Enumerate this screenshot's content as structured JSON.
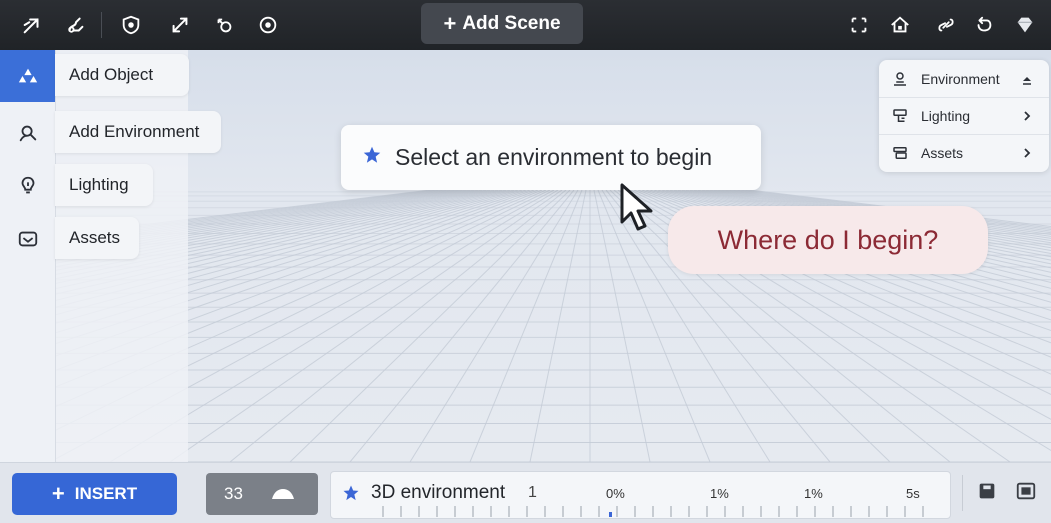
{
  "toolbar": {
    "left_icons": [
      "cursor-arrow-icon",
      "link-path-icon",
      "shield-icon",
      "scale-arrows-icon",
      "rotate-icon",
      "target-icon"
    ],
    "add_scene_label": "Add Scene",
    "right_icons": [
      "frame-icon",
      "home-icon",
      "link-icon",
      "undo-icon",
      "diamond-icon"
    ]
  },
  "sidebar": {
    "items": [
      {
        "label": "Add Object",
        "icon": "objects-icon",
        "active": true
      },
      {
        "label": "Add Environment",
        "icon": "person-search-icon",
        "active": false
      },
      {
        "label": "Lighting",
        "icon": "lightbulb-icon",
        "active": false
      },
      {
        "label": "Assets",
        "icon": "image-box-icon",
        "active": false
      }
    ]
  },
  "prompt": {
    "text": "Select an environment to begin",
    "icon": "star-icon"
  },
  "bubble": {
    "text": "Where do I begin?"
  },
  "right_panel": {
    "items": [
      {
        "label": "Environment",
        "icon": "person-pin-icon",
        "chevron": "up"
      },
      {
        "label": "Lighting",
        "icon": "lighting-rig-icon",
        "chevron": "right"
      },
      {
        "label": "Assets",
        "icon": "stack-icon",
        "chevron": "right"
      }
    ]
  },
  "bottombar": {
    "insert_label": "INSERT",
    "mode_value": "33",
    "timeline": {
      "label": "3D environment",
      "count": "1",
      "ticks": [
        "0%",
        "1%",
        "1%",
        "5s"
      ]
    }
  },
  "colors": {
    "accent": "#3667d6",
    "topbar": "#25282d",
    "bubble_text": "#8c2a35",
    "bubble_bg": "#f7e9ea"
  }
}
